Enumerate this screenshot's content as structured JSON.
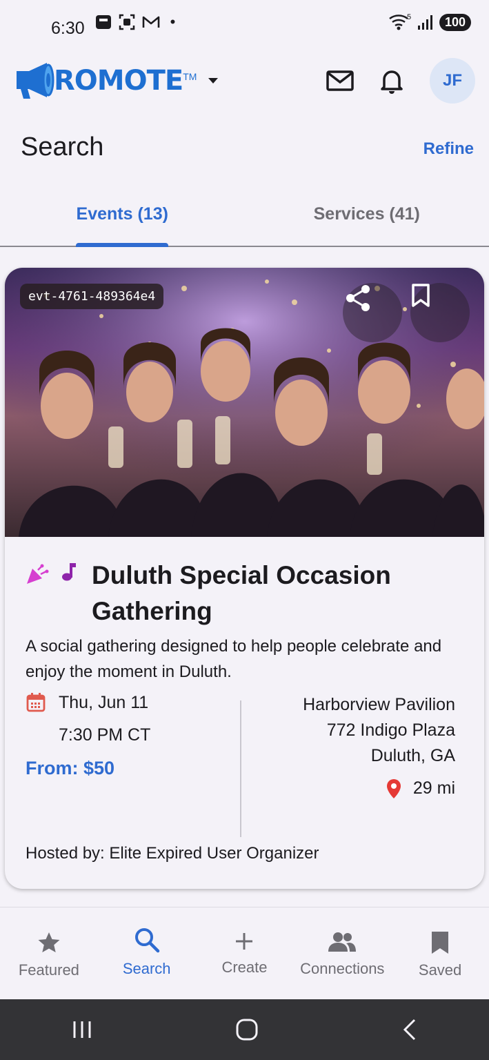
{
  "status": {
    "time": "6:30",
    "battery": "100",
    "signal": "5"
  },
  "app": {
    "logo_text": "ROMOTE",
    "logo_tm": "TM",
    "avatar": "JF"
  },
  "page": {
    "title": "Search",
    "refine": "Refine"
  },
  "tabs": [
    {
      "label": "Events (13)",
      "active": true
    },
    {
      "label": "Services (41)",
      "active": false
    }
  ],
  "event": {
    "id": "evt-4761-489364e4",
    "title": "Duluth Special Occasion Gathering",
    "description": "A social gathering designed to help people celebrate and enjoy the moment in Duluth.",
    "date": "Thu, Jun 11",
    "time": "7:30 PM CT",
    "price": "From: $50",
    "venue": "Harborview Pavilion",
    "street": "772 Indigo Plaza",
    "city": "Duluth, GA",
    "distance": "29 mi",
    "host": "Hosted by: Elite Expired User Organizer"
  },
  "nav": {
    "featured": "Featured",
    "search": "Search",
    "create": "Create",
    "connections": "Connections",
    "saved": "Saved"
  },
  "colors": {
    "accent": "#2f6bd0",
    "pin": "#e53935",
    "party": "#d63fd0",
    "music": "#8e24aa"
  }
}
